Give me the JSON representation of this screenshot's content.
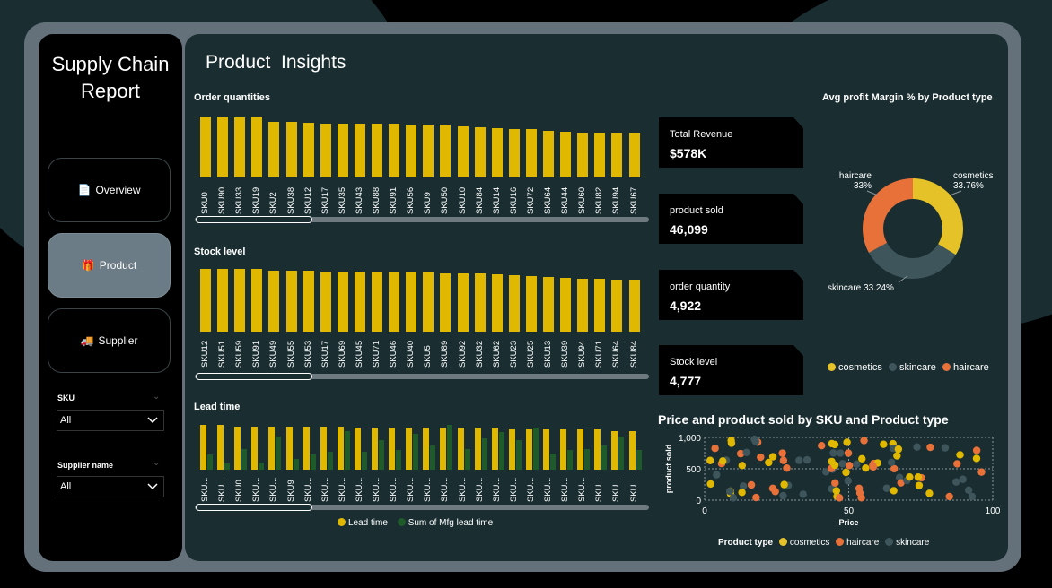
{
  "sidebar": {
    "title_line1": "Supply Chain",
    "title_line2": "Report",
    "nav": [
      {
        "label": "Overview",
        "icon": "📄"
      },
      {
        "label": "Product",
        "icon": "🎁"
      },
      {
        "label": "Supplier",
        "icon": "🚚"
      }
    ],
    "slicers": [
      {
        "label": "SKU",
        "value": "All"
      },
      {
        "label": "Supplier name",
        "value": "All"
      }
    ]
  },
  "main": {
    "page_title": "Product  Insights"
  },
  "colors": {
    "gold": "#e0b800",
    "orange": "#e8713a",
    "slate": "#3e555c",
    "green": "#1f5a2a"
  },
  "order_quantities": {
    "title": "Order quantities",
    "categories": [
      "SKU0",
      "SKU90",
      "SKU33",
      "SKU19",
      "SKU2",
      "SKU38",
      "SKU12",
      "SKU17",
      "SKU35",
      "SKU43",
      "SKU88",
      "SKU91",
      "SKU56",
      "SKU9",
      "SKU50",
      "SKU10",
      "SKU84",
      "SKU14",
      "SKU16",
      "SKU72",
      "SKU64",
      "SKU44",
      "SKU60",
      "SKU82",
      "SKU94",
      "SKU67"
    ],
    "values": [
      96,
      96,
      95,
      94,
      88,
      88,
      86,
      85,
      85,
      85,
      85,
      85,
      84,
      84,
      83,
      80,
      79,
      78,
      76,
      76,
      73,
      72,
      71,
      71,
      70,
      70
    ]
  },
  "stock_level": {
    "title": "Stock level",
    "categories": [
      "SKU12",
      "SKU51",
      "SKU59",
      "SKU91",
      "SKU49",
      "SKU55",
      "SKU53",
      "SKU17",
      "SKU69",
      "SKU45",
      "SKU71",
      "SKU46",
      "SKU40",
      "SKU5",
      "SKU89",
      "SKU92",
      "SKU32",
      "SKU62",
      "SKU23",
      "SKU25",
      "SKU13",
      "SKU39",
      "SKU94",
      "SKU71",
      "SKU64",
      "SKU84"
    ],
    "values": [
      100,
      100,
      100,
      100,
      97,
      97,
      97,
      96,
      96,
      96,
      95,
      94,
      94,
      94,
      93,
      93,
      93,
      91,
      90,
      89,
      87,
      86,
      85,
      84,
      83,
      83
    ]
  },
  "lead_time": {
    "title": "Lead time",
    "categories": [
      "SKU...",
      "SKU...",
      "SKU0",
      "SKU...",
      "SKU...",
      "SKU9",
      "SKU...",
      "SKU...",
      "SKU...",
      "SKU...",
      "SKU...",
      "SKU...",
      "SKU...",
      "SKU...",
      "SKU...",
      "SKU...",
      "SKU...",
      "SKU...",
      "SKU...",
      "SKU...",
      "SKU...",
      "SKU...",
      "SKU...",
      "SKU...",
      "SKU...",
      "SKU..."
    ],
    "lead_values": [
      30,
      30,
      29,
      29,
      29,
      29,
      29,
      29,
      29,
      28,
      28,
      28,
      28,
      28,
      28,
      28,
      28,
      28,
      27,
      27,
      27,
      27,
      27,
      27,
      26,
      26
    ],
    "mfg_values": [
      10,
      4,
      14,
      5,
      22,
      7,
      10,
      12,
      26,
      12,
      20,
      13,
      24,
      16,
      30,
      14,
      21,
      25,
      20,
      28,
      11,
      13,
      14,
      16,
      22,
      13
    ],
    "legend": [
      "Lead time",
      "Sum of Mfg lead time"
    ]
  },
  "kpis": [
    {
      "label": "Total Revenue",
      "value": "$578K"
    },
    {
      "label": "product sold",
      "value": "46,099"
    },
    {
      "label": "order quantity",
      "value": "4,922"
    },
    {
      "label": "Stock level",
      "value": "4,777"
    }
  ],
  "donut": {
    "title": "Avg profit Margin % by Product type",
    "slices": [
      {
        "name": "cosmetics",
        "pct": 33.76,
        "label": "33.76%",
        "color": "#e6c229"
      },
      {
        "name": "skincare",
        "pct": 33.24,
        "label": "33.24%",
        "color": "#3e555c"
      },
      {
        "name": "haircare",
        "pct": 33.0,
        "label": "33%",
        "color": "#e8713a"
      }
    ],
    "legend": [
      "cosmetics",
      "skincare",
      "haircare"
    ]
  },
  "scatter": {
    "title": "Price and product sold by SKU and Product type",
    "xlabel": "Price",
    "ylabel": "product sold",
    "xticks": [
      "0",
      "50",
      "100"
    ],
    "yticks": [
      "1,000",
      "500",
      "0"
    ],
    "legend_title": "Product type",
    "legend": [
      "cosmetics",
      "haircare",
      "skincare"
    ]
  }
}
